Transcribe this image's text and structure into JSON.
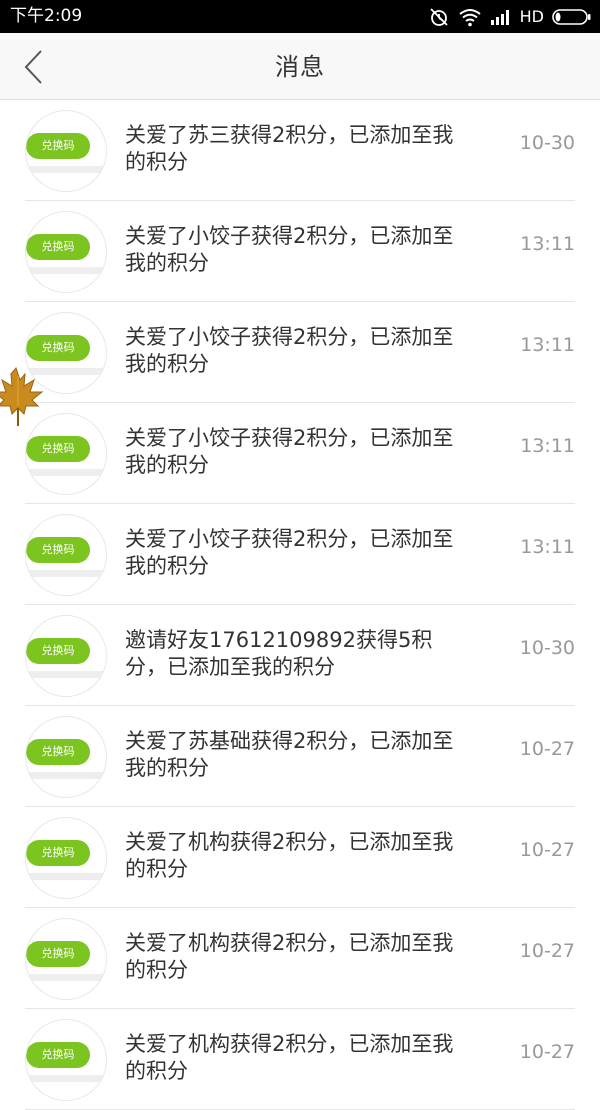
{
  "status_bar": {
    "time": "下午2:09",
    "network": "HD"
  },
  "header": {
    "title": "消息",
    "back_icon": "chevron-left-icon"
  },
  "colors": {
    "accent_green": "#7cc41f",
    "text_primary": "#333333",
    "text_secondary": "#999999",
    "nav_background": "#f8f8f8"
  },
  "messages": [
    {
      "badge": "兑换码",
      "text": "关爱了苏三获得2积分，已添加至我的积分",
      "time": "10-30"
    },
    {
      "badge": "兑换码",
      "text": "关爱了小饺子获得2积分，已添加至我的积分",
      "time": "13:11"
    },
    {
      "badge": "兑换码",
      "text": "关爱了小饺子获得2积分，已添加至我的积分",
      "time": "13:11"
    },
    {
      "badge": "兑换码",
      "text": "关爱了小饺子获得2积分，已添加至我的积分",
      "time": "13:11"
    },
    {
      "badge": "兑换码",
      "text": "关爱了小饺子获得2积分，已添加至我的积分",
      "time": "13:11"
    },
    {
      "badge": "兑换码",
      "text": "邀请好友17612109892获得5积分，已添加至我的积分",
      "time": "10-30"
    },
    {
      "badge": "兑换码",
      "text": "关爱了苏基础获得2积分，已添加至我的积分",
      "time": "10-27"
    },
    {
      "badge": "兑换码",
      "text": "关爱了机构获得2积分，已添加至我的积分",
      "time": "10-27"
    },
    {
      "badge": "兑换码",
      "text": "关爱了机构获得2积分，已添加至我的积分",
      "time": "10-27"
    },
    {
      "badge": "兑换码",
      "text": "关爱了机构获得2积分，已添加至我的积分",
      "time": "10-27"
    }
  ]
}
